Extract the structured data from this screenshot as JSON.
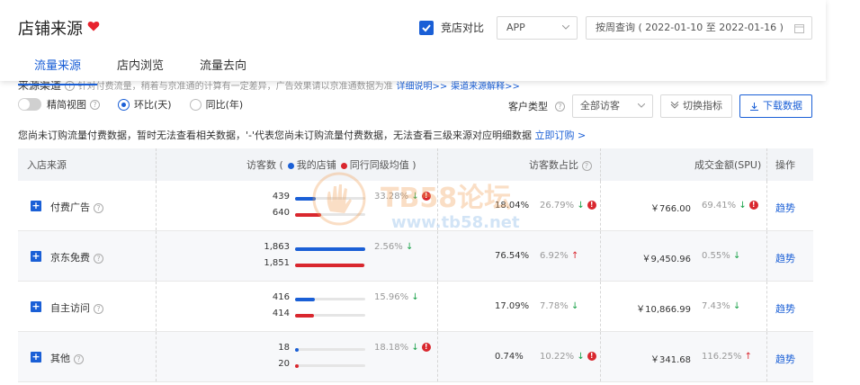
{
  "header": {
    "title": "店铺来源",
    "compare_label": "竞店对比",
    "platform_value": "APP",
    "date_range": "按周查询 ( 2022-01-10 至 2022-01-16 )"
  },
  "tabs": [
    {
      "label": "流量来源",
      "active": true
    },
    {
      "label": "店内浏览",
      "active": false
    },
    {
      "label": "流量去向",
      "active": false
    }
  ],
  "section": {
    "title": "来源渠道",
    "hint": "针对付费流量，稍着与京准通的计算有一定差异，广告效果请以京准通数据为准",
    "link1": "详细说明>>",
    "link2": "渠道来源解释>>"
  },
  "controls": {
    "fine_view": "精简视图",
    "radio_day": "环比(天)",
    "radio_year": "同比(年)",
    "customer_type_label": "客户类型",
    "visitor_select": "全部访客",
    "switch_metric": "切换指标",
    "download": "下载数据"
  },
  "notice": {
    "text": "您尚未订购流量付费数据，暂时无法查看相关数据，'-'代表您尚未订购流量付费数据，无法查看三级来源对应明细数据",
    "link": "立即订购 >"
  },
  "table": {
    "headers": {
      "source": "入店来源",
      "visitors": "访客数 (",
      "my_store": "我的店铺",
      "peer_avg": "同行同级均值 )",
      "visitor_ratio": "访客数占比",
      "gmv": "成交金额(SPU)",
      "action": "操作"
    },
    "rows": [
      {
        "name": "付费广告",
        "mine": "439",
        "peer": "640",
        "mine_fill": 0.29,
        "peer_fill": 0.37,
        "v_pct": "33.28%",
        "v_dir": "down",
        "v_warn": true,
        "ratio": "18.04%",
        "ratio_pct": "26.79%",
        "ratio_dir": "down",
        "ratio_warn": true,
        "gmv": "￥766.00",
        "gmv_pct": "69.41%",
        "gmv_dir": "down",
        "gmv_warn": true,
        "action": "趋势"
      },
      {
        "name": "京东免费",
        "mine": "1,863",
        "peer": "1,851",
        "mine_fill": 1.0,
        "peer_fill": 0.99,
        "v_pct": "2.56%",
        "v_dir": "down",
        "v_warn": false,
        "ratio": "76.54%",
        "ratio_pct": "6.92%",
        "ratio_dir": "up",
        "ratio_warn": false,
        "gmv": "￥9,450.96",
        "gmv_pct": "0.55%",
        "gmv_dir": "down",
        "gmv_warn": false,
        "action": "趋势"
      },
      {
        "name": "自主访问",
        "mine": "416",
        "peer": "414",
        "mine_fill": 0.28,
        "peer_fill": 0.27,
        "v_pct": "15.96%",
        "v_dir": "down",
        "v_warn": false,
        "ratio": "17.09%",
        "ratio_pct": "7.78%",
        "ratio_dir": "down",
        "ratio_warn": false,
        "gmv": "￥10,866.99",
        "gmv_pct": "7.43%",
        "gmv_dir": "down",
        "gmv_warn": false,
        "action": "趋势"
      },
      {
        "name": "其他",
        "mine": "18",
        "peer": "20",
        "mine_fill": 0.05,
        "peer_fill": 0.05,
        "v_pct": "18.18%",
        "v_dir": "down",
        "v_warn": true,
        "ratio": "0.74%",
        "ratio_pct": "10.22%",
        "ratio_dir": "down",
        "ratio_warn": true,
        "gmv": "￥341.68",
        "gmv_pct": "116.25%",
        "gmv_dir": "up",
        "gmv_warn": false,
        "action": "趋势"
      }
    ]
  },
  "watermark": {
    "main": "TB58论坛",
    "url": "www.tb58.net"
  },
  "colors": {
    "accent": "#1a5fd6",
    "red": "#d9272e",
    "green": "#1ba24a"
  }
}
